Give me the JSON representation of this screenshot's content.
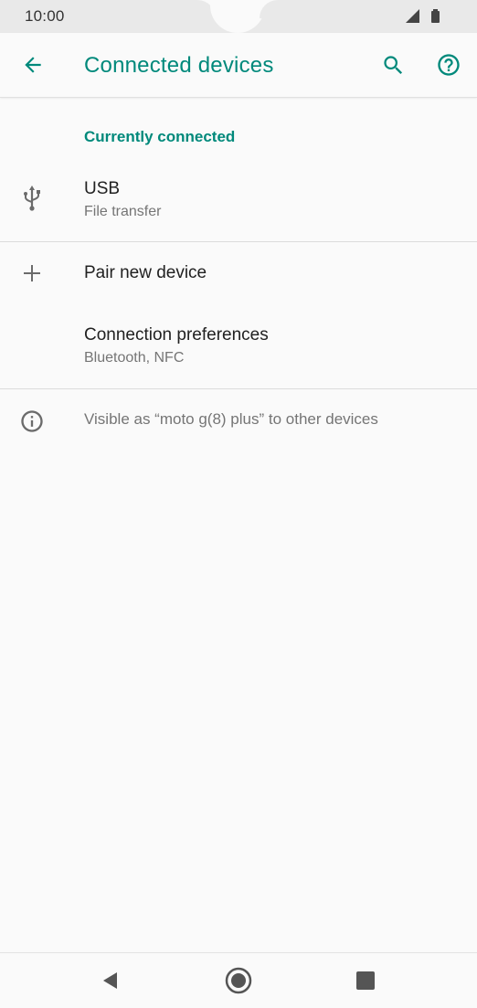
{
  "status_bar": {
    "time": "10:00"
  },
  "app_bar": {
    "title": "Connected devices",
    "back_icon": "arrow-back-icon",
    "search_icon": "search-icon",
    "help_icon": "help-circle-icon"
  },
  "sections": {
    "currently_connected": {
      "header": "Currently connected",
      "items": [
        {
          "title": "USB",
          "subtitle": "File transfer",
          "icon": "usb-icon"
        }
      ]
    },
    "actions": {
      "items": [
        {
          "title": "Pair new device",
          "icon": "plus-icon"
        },
        {
          "title": "Connection preferences",
          "subtitle": "Bluetooth, NFC"
        }
      ]
    },
    "footer": {
      "text": "Visible as “moto g(8) plus” to other devices",
      "icon": "info-icon"
    }
  },
  "nav_bar": {
    "back": "nav-back-icon",
    "home": "nav-home-icon",
    "recents": "nav-recents-icon"
  },
  "colors": {
    "accent": "#00897b",
    "text_primary": "#212121",
    "text_secondary": "#757575",
    "background": "#fafafa"
  }
}
